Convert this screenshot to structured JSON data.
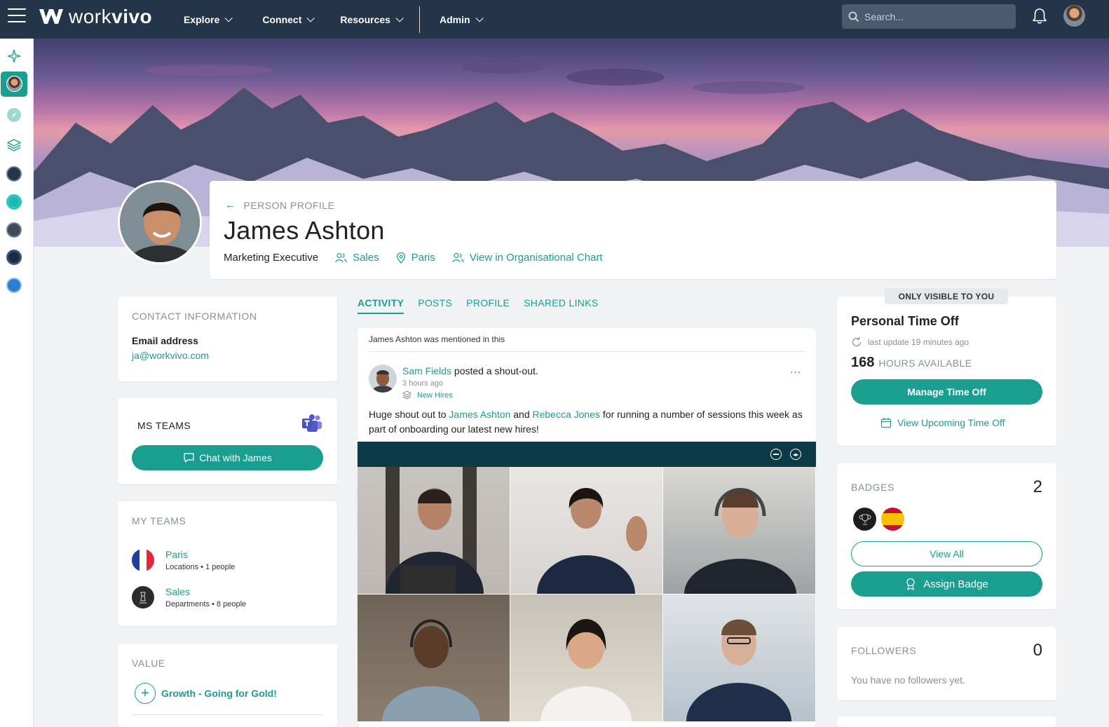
{
  "brand": {
    "name_light": "work",
    "name_bold": "vivo",
    "accent": "#1a9e8f",
    "navbar_bg": "#243449"
  },
  "nav": {
    "items": [
      {
        "label": "Explore"
      },
      {
        "label": "Connect"
      },
      {
        "label": "Resources"
      },
      {
        "label": "Admin"
      }
    ],
    "search_placeholder": "Search..."
  },
  "profile": {
    "breadcrumb": "PERSON PROFILE",
    "name": "James Ashton",
    "job_title": "Marketing Executive",
    "department": "Sales",
    "location": "Paris",
    "org_chart_link": "View in Organisational Chart"
  },
  "contact": {
    "heading": "CONTACT INFORMATION",
    "email_label": "Email address",
    "email": "ja@workvivo.com"
  },
  "ms_teams": {
    "heading": "MS TEAMS",
    "button": "Chat with James"
  },
  "my_teams": {
    "heading": "MY TEAMS",
    "items": [
      {
        "name": "Paris",
        "meta": "Locations • 1 people"
      },
      {
        "name": "Sales",
        "meta": "Departments • 8 people"
      }
    ]
  },
  "value": {
    "heading": "VALUE",
    "item": "Growth - Going for Gold!"
  },
  "feed": {
    "tabs": [
      "ACTIVITY",
      "POSTS",
      "PROFILE",
      "SHARED LINKS"
    ],
    "mention_note": "James Ashton was mentioned in this",
    "post": {
      "author": "Sam Fields",
      "action": " posted a shout-out.",
      "time": "3 hours ago",
      "space": "New Hires",
      "text_1": "Huge shout out to ",
      "mention_1": "James Ashton",
      "text_2": " and ",
      "mention_2": "Rebecca Jones",
      "text_3": " for running a number of sessions this week as part of onboarding our latest new hires!",
      "more": "..."
    }
  },
  "time_off": {
    "visibility": "ONLY VISIBLE TO YOU",
    "title": "Personal Time Off",
    "last_update": "last update 19 minutes ago",
    "hours": "168",
    "hours_label": "HOURS AVAILABLE",
    "manage_button": "Manage Time Off",
    "upcoming_link": "View Upcoming Time Off"
  },
  "badges": {
    "heading": "BADGES",
    "count": "2",
    "view_all": "View All",
    "assign": "Assign Badge"
  },
  "followers": {
    "heading": "FOLLOWERS",
    "count": "0",
    "empty": "You have no followers yet."
  }
}
